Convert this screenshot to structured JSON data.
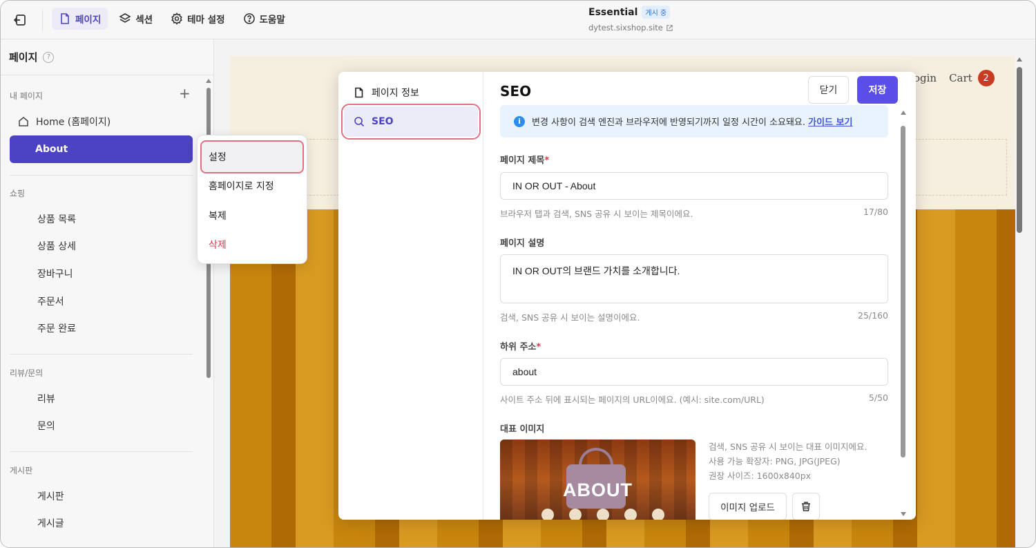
{
  "topbar": {
    "tabs": [
      {
        "label": "페이지",
        "icon": "page-icon",
        "active": true
      },
      {
        "label": "섹션",
        "icon": "layers-icon",
        "active": false
      },
      {
        "label": "테마 설정",
        "icon": "gear-icon",
        "active": false
      },
      {
        "label": "도움말",
        "icon": "help-icon",
        "active": false
      }
    ],
    "site_title": "Essential",
    "status_badge": "게시 중",
    "site_url": "dytest.sixshop.site"
  },
  "sidebar": {
    "title": "페이지",
    "my_pages_label": "내 페이지",
    "home_label": "Home (홈페이지)",
    "about_label": "About",
    "shopping_label": "쇼핑",
    "shopping_items": [
      "상품 목록",
      "상품 상세",
      "장바구니",
      "주문서",
      "주문 완료"
    ],
    "review_label": "리뷰/문의",
    "review_items": [
      "리뷰",
      "문의"
    ],
    "board_label": "게시판",
    "board_items": [
      "게시판",
      "게시글"
    ]
  },
  "context_menu": {
    "items": [
      "설정",
      "홈페이지로 지정",
      "복제",
      "삭제"
    ]
  },
  "preview": {
    "login": "Login",
    "cart": "Cart",
    "cart_count": "2"
  },
  "modal": {
    "nav": {
      "page_info": "페이지 정보",
      "seo": "SEO"
    },
    "title": "SEO",
    "close_label": "닫기",
    "save_label": "저장",
    "info_text": "변경 사항이 검색 엔진과 브라우저에 반영되기까지 일정 시간이 소요돼요.",
    "info_link": "가이드 보기",
    "page_title_label": "페이지 제목",
    "page_title_value": "IN OR OUT - About",
    "page_title_hint": "브라우저 탭과 검색, SNS 공유 시 보이는 제목이에요.",
    "page_title_count": "17/80",
    "page_desc_label": "페이지 설명",
    "page_desc_value": "IN OR OUT의 브랜드 가치를 소개합니다.",
    "page_desc_hint": "검색, SNS 공유 시 보이는 설명이에요.",
    "page_desc_count": "25/160",
    "sub_address_label": "하위 주소",
    "sub_address_value": "about",
    "sub_address_hint": "사이트 주소 뒤에 표시되는 페이지의 URL이에요. (예시: site.com/URL)",
    "sub_address_count": "5/50",
    "rep_image_label": "대표 이미지",
    "rep_image_text": "ABOUT",
    "rep_image_info": [
      "검색, SNS 공유 시 보이는 대표 이미지에요.",
      "사용 가능 확장자: PNG, JPG(JPEG)",
      "권장 사이즈: 1600x840px"
    ],
    "upload_label": "이미지 업로드"
  },
  "colors": {
    "accent": "#5b4ee8",
    "selected_page": "#4b42c4",
    "danger": "#e0354c",
    "highlight_ring": "#e0707f"
  }
}
